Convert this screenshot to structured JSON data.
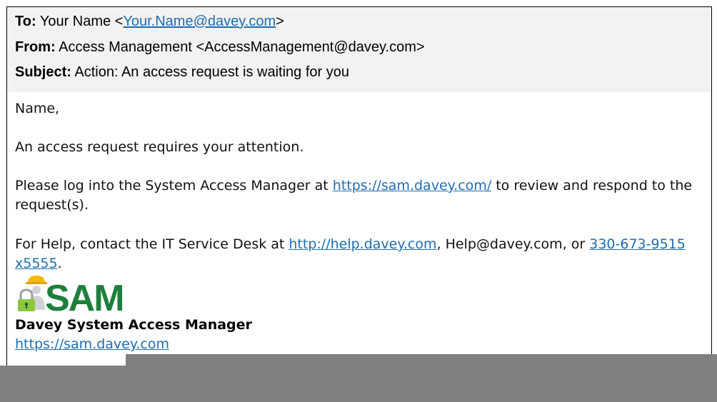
{
  "header": {
    "to_label": "To:",
    "to_name": "Your Name <",
    "to_email": "Your.Name@davey.com",
    "to_close": ">",
    "from_label": "From:",
    "from_value": "Access Management <AccessManagement@davey.com>",
    "subject_label": "Subject:",
    "subject_value": "Action: An access request is waiting for you"
  },
  "body": {
    "greeting": "Name,",
    "line1": "An access request requires your attention.",
    "line2_before": "Please log into the System Access Manager at ",
    "line2_link": "https://sam.davey.com/",
    "line2_after": " to review and respond to the request(s).",
    "line3_before": "For Help, contact the IT Service Desk at ",
    "line3_link1": "http://help.davey.com",
    "line3_mid": ", Help@davey.com, or ",
    "line3_link2": "330-673-9515 x5555",
    "line3_end": "."
  },
  "signature": {
    "logo_text": "SAM",
    "name": "Davey System Access Manager",
    "url": "https://sam.davey.com"
  },
  "colors": {
    "link": "#1f6cb0",
    "logo_green": "#1e7f3c",
    "lock_green": "#8dc63f",
    "hardhat_yellow": "#f5b800",
    "header_bg": "#f2f2f2"
  }
}
